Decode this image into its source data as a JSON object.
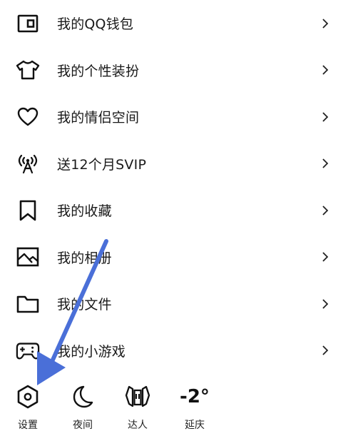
{
  "menu": {
    "items": [
      {
        "label": "我的QQ钱包",
        "icon": "wallet-icon"
      },
      {
        "label": "我的个性装扮",
        "icon": "tshirt-icon"
      },
      {
        "label": "我的情侣空间",
        "icon": "heart-icon"
      },
      {
        "label": "送12个月SVIP",
        "icon": "broadcast-icon"
      },
      {
        "label": "我的收藏",
        "icon": "bookmark-icon"
      },
      {
        "label": "我的相册",
        "icon": "image-icon"
      },
      {
        "label": "我的文件",
        "icon": "folder-icon"
      },
      {
        "label": "我的小游戏",
        "icon": "gamepad-icon"
      }
    ],
    "chevron": "›"
  },
  "bottom_bar": {
    "settings_label": "设置",
    "night_label": "夜间",
    "expert_label": "达人",
    "weather_temp": "-2°",
    "weather_city": "延庆"
  },
  "annotation": {
    "arrow_color": "#4a6fd8",
    "points_to": "settings-button"
  }
}
